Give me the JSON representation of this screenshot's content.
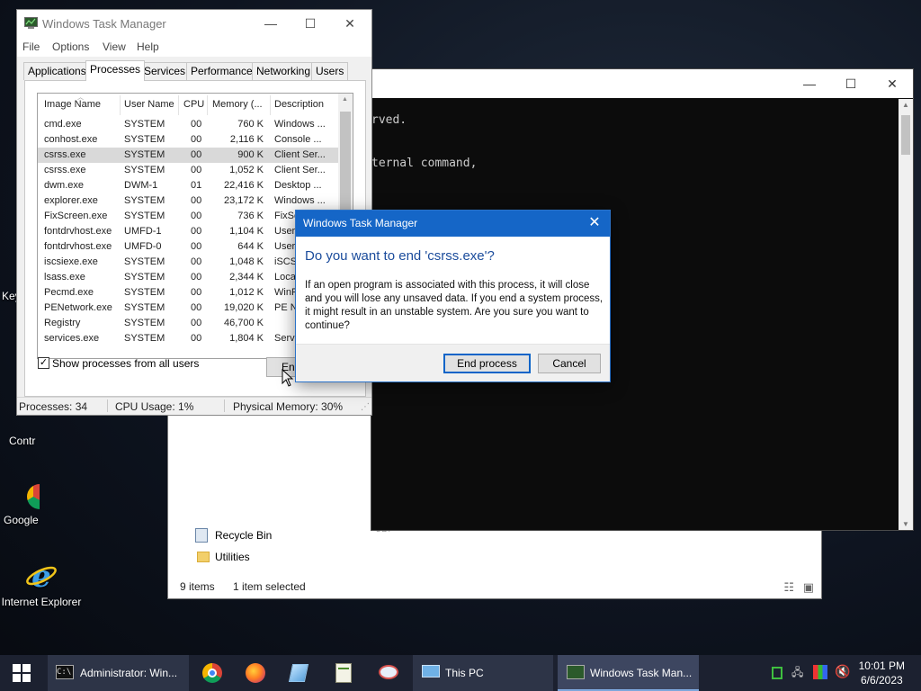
{
  "desktop": {
    "icons": [
      {
        "label": "Internet Explorer"
      }
    ],
    "partial_labels": [
      "Key",
      "Contr",
      "Google"
    ]
  },
  "explorer": {
    "rows": [
      "Recycle Bin",
      "Utilities"
    ],
    "partial_text": "UDP",
    "status_items": "9 items",
    "status_selected": "1 item selected"
  },
  "cmd": {
    "title": "Administrator: Windows Command Processor",
    "lines": [
      "rved.",
      "ternal command,"
    ]
  },
  "taskmgr": {
    "title": "Windows Task Manager",
    "menu": [
      "File",
      "Options",
      "View",
      "Help"
    ],
    "tabs": [
      "Applications",
      "Processes",
      "Services",
      "Performance",
      "Networking",
      "Users"
    ],
    "active_tab": "Processes",
    "columns": [
      "Image Name",
      "User Name",
      "CPU",
      "Memory (...",
      "Description"
    ],
    "processes": [
      {
        "name": "cmd.exe",
        "user": "SYSTEM",
        "cpu": "00",
        "mem": "760 K",
        "desc": "Windows ..."
      },
      {
        "name": "conhost.exe",
        "user": "SYSTEM",
        "cpu": "00",
        "mem": "2,116 K",
        "desc": "Console ..."
      },
      {
        "name": "csrss.exe",
        "user": "SYSTEM",
        "cpu": "00",
        "mem": "900 K",
        "desc": "Client Ser...",
        "selected": true
      },
      {
        "name": "csrss.exe",
        "user": "SYSTEM",
        "cpu": "00",
        "mem": "1,052 K",
        "desc": "Client Ser..."
      },
      {
        "name": "dwm.exe",
        "user": "DWM-1",
        "cpu": "01",
        "mem": "22,416 K",
        "desc": "Desktop ..."
      },
      {
        "name": "explorer.exe",
        "user": "SYSTEM",
        "cpu": "00",
        "mem": "23,172 K",
        "desc": "Windows ..."
      },
      {
        "name": "FixScreen.exe",
        "user": "SYSTEM",
        "cpu": "00",
        "mem": "736 K",
        "desc": "FixSc"
      },
      {
        "name": "fontdrvhost.exe",
        "user": "UMFD-1",
        "cpu": "00",
        "mem": "1,104 K",
        "desc": "User"
      },
      {
        "name": "fontdrvhost.exe",
        "user": "UMFD-0",
        "cpu": "00",
        "mem": "644 K",
        "desc": "User"
      },
      {
        "name": "iscsiexe.exe",
        "user": "SYSTEM",
        "cpu": "00",
        "mem": "1,048 K",
        "desc": "iSCSI"
      },
      {
        "name": "lsass.exe",
        "user": "SYSTEM",
        "cpu": "00",
        "mem": "2,344 K",
        "desc": "Loca"
      },
      {
        "name": "Pecmd.exe",
        "user": "SYSTEM",
        "cpu": "00",
        "mem": "1,012 K",
        "desc": "WinP"
      },
      {
        "name": "PENetwork.exe",
        "user": "SYSTEM",
        "cpu": "00",
        "mem": "19,020 K",
        "desc": "PE N"
      },
      {
        "name": "Registry",
        "user": "SYSTEM",
        "cpu": "00",
        "mem": "46,700 K",
        "desc": ""
      },
      {
        "name": "services.exe",
        "user": "SYSTEM",
        "cpu": "00",
        "mem": "1,804 K",
        "desc": "Serv"
      }
    ],
    "show_all_label": "Show processes from all users",
    "show_all_checked": true,
    "end_button_partial": "End",
    "status": {
      "processes": "Processes: 34",
      "cpu": "CPU Usage: 1%",
      "memory": "Physical Memory: 30%"
    }
  },
  "dialog": {
    "title": "Windows Task Manager",
    "question": "Do you want to end 'csrss.exe'?",
    "message": "If an open program is associated with this process, it will close and you will lose any unsaved data. If you end a system process, it might result in an unstable system. Are you sure you want to continue?",
    "ok_label": "End process",
    "cancel_label": "Cancel"
  },
  "taskbar": {
    "cmd_label": "Administrator: Win...",
    "thispc_label": "This PC",
    "taskmgr_label": "Windows Task Man...",
    "time": "10:01 PM",
    "date": "6/6/2023"
  },
  "colors": {
    "accent": "#1566c7",
    "taskbar": "#1c2130",
    "dialog_question": "#1b4c9c"
  }
}
